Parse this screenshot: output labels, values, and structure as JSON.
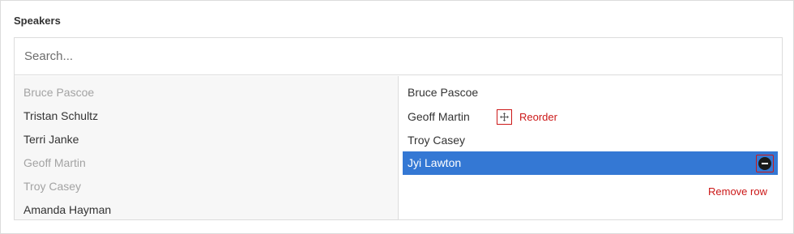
{
  "field": {
    "label": "Speakers"
  },
  "search": {
    "placeholder": "Search..."
  },
  "choices": [
    {
      "label": "Bruce Pascoe",
      "disabled": true
    },
    {
      "label": "Tristan Schultz",
      "disabled": false
    },
    {
      "label": "Terri Janke",
      "disabled": false
    },
    {
      "label": "Geoff Martin",
      "disabled": true
    },
    {
      "label": "Troy Casey",
      "disabled": true
    },
    {
      "label": "Amanda Hayman",
      "disabled": false
    }
  ],
  "selected": [
    {
      "label": "Bruce Pascoe"
    },
    {
      "label": "Geoff Martin"
    },
    {
      "label": "Troy Casey"
    },
    {
      "label": "Jyi Lawton"
    }
  ],
  "annotations": {
    "reorder": "Reorder",
    "remove_row": "Remove row"
  },
  "colors": {
    "accent": "#3478d4",
    "annotation": "#cc1818"
  }
}
